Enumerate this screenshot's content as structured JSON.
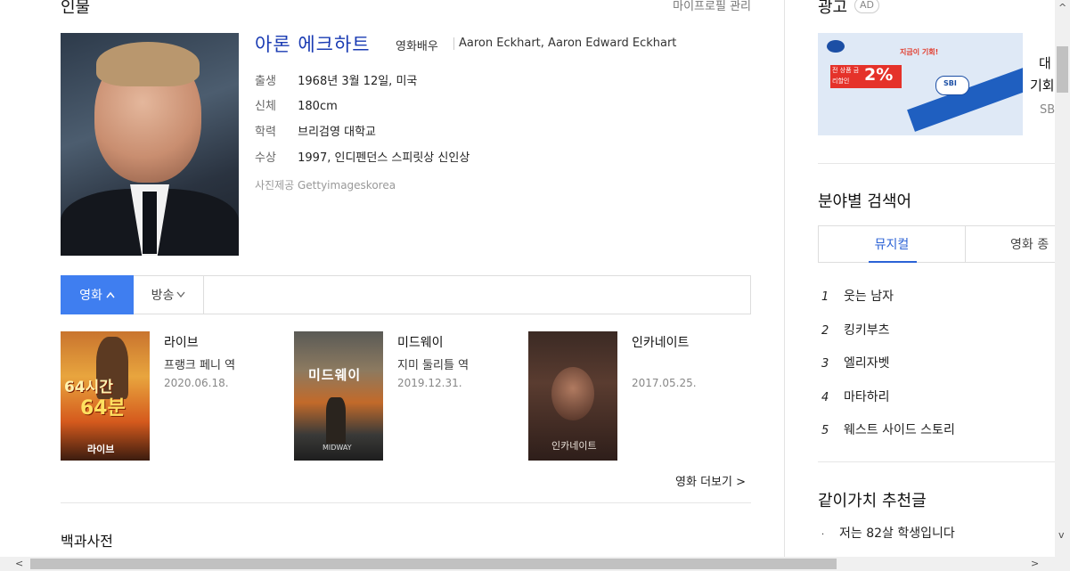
{
  "profile": {
    "section_title": "인물",
    "manage_link": "마이프로필 관리",
    "name": "아론 에크하트",
    "job": "영화배우",
    "english_name": "Aaron Eckhart, Aaron Edward Eckhart",
    "details": [
      {
        "key": "출생",
        "value": "1968년 3월 12일, 미국"
      },
      {
        "key": "신체",
        "value": "180cm"
      },
      {
        "key": "학력",
        "value": "브리검영 대학교"
      },
      {
        "key": "수상",
        "value": "1997, 인디펜던스 스피릿상 신인상"
      }
    ],
    "photo_credit": "사진제공 Gettyimageskorea"
  },
  "tabs": {
    "movie": "영화",
    "movie_chevron": "^",
    "tv": "방송",
    "tv_chevron": "v"
  },
  "films": [
    {
      "title": "라이브",
      "role": "프랭크 페니 역",
      "date": "2020.06.18.",
      "poster_text_top": "64시간",
      "poster_text_mid": "64분",
      "poster_text_bottom": "라이브"
    },
    {
      "title": "미드웨이",
      "role": "지미 둘리틀 역",
      "date": "2019.12.31.",
      "poster_text_top": "미드웨이",
      "poster_text_mid": "",
      "poster_text_bottom": "MIDWAY"
    },
    {
      "title": "인카네이트",
      "role": "",
      "date": "2017.05.25.",
      "poster_text_top": "",
      "poster_text_mid": "",
      "poster_text_bottom": "인카네이트"
    }
  ],
  "more_movies": "영화 더보기 >",
  "encyclopedia_title": "백과사전",
  "sidebar": {
    "ad_title": "광고",
    "ad_badge": "AD",
    "ad_text_1": "대",
    "ad_text_2": "기회",
    "ad_text_3": "SB",
    "banner_headline": "지금이 기회!",
    "banner_sub": "전 상품 금리할인",
    "banner_percent": "2%",
    "banner_brand": "SBI",
    "category_title": "분야별 검색어",
    "category_tabs": [
      "뮤지컬",
      "영화 종"
    ],
    "ranking": [
      {
        "rank": "1",
        "title": "웃는 남자"
      },
      {
        "rank": "2",
        "title": "킹키부츠"
      },
      {
        "rank": "3",
        "title": "엘리자벳"
      },
      {
        "rank": "4",
        "title": "마타하리"
      },
      {
        "rank": "5",
        "title": "웨스트 사이드 스토리"
      }
    ],
    "recommend_title": "같이가치 추천글",
    "recommend_item": "저는 82살 학생입니다"
  },
  "scrollbars": {
    "up": "^",
    "down": "v",
    "left": "<",
    "right": ">"
  },
  "colors": {
    "accent": "#3f7ef0",
    "name_link": "#1a3bb3"
  }
}
